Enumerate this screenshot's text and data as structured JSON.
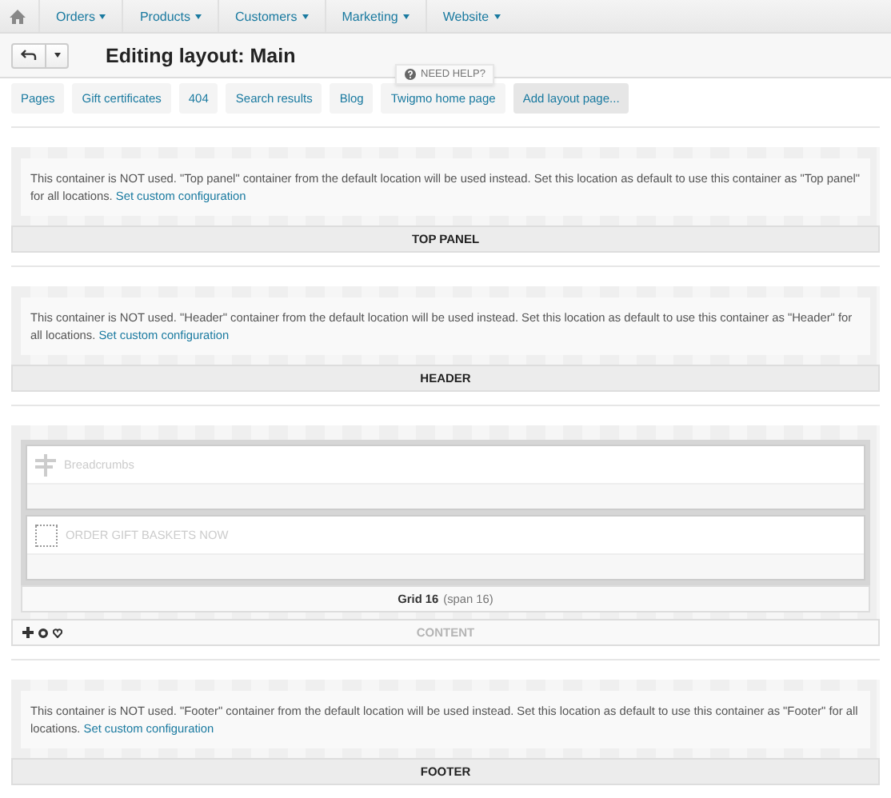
{
  "top_menu": [
    {
      "label": "Orders"
    },
    {
      "label": "Products"
    },
    {
      "label": "Customers"
    },
    {
      "label": "Marketing"
    },
    {
      "label": "Website"
    }
  ],
  "toolbar": {
    "title": "Editing layout: Main"
  },
  "help": {
    "label": "NEED HELP?"
  },
  "tabs": [
    {
      "label": "Pages",
      "kind": "page"
    },
    {
      "label": "Gift certificates",
      "kind": "page"
    },
    {
      "label": "404",
      "kind": "page"
    },
    {
      "label": "Search results",
      "kind": "page"
    },
    {
      "label": "Blog",
      "kind": "page"
    },
    {
      "label": "Twigmo home page",
      "kind": "page"
    },
    {
      "label": "Add layout page...",
      "kind": "add"
    }
  ],
  "containers": [
    {
      "kind": "unused",
      "message": "This container is NOT used. \"Top panel\" container from the default location will be used instead. Set this location as default to use this container as \"Top panel\" for all locations.",
      "link": "Set custom configuration",
      "label": "TOP PANEL"
    },
    {
      "kind": "unused",
      "message": "This container is NOT used. \"Header\" container from the default location will be used instead. Set this location as default to use this container as \"Header\" for all locations.",
      "link": "Set custom configuration",
      "label": "HEADER"
    },
    {
      "kind": "content",
      "blocks": [
        {
          "kind": "breadcrumbs",
          "title": "Breadcrumbs"
        },
        {
          "kind": "banner",
          "title": "ORDER GIFT BASKETS NOW"
        }
      ],
      "grid": "**Grid 16** (span 16)",
      "label": "CONTENT"
    },
    {
      "kind": "unused",
      "message": "This container is NOT used. \"Footer\" container from the default location will be used instead. Set this location as default to use this container as \"Footer\" for all locations.",
      "link": "Set custom configuration",
      "label": "FOOTER"
    }
  ]
}
